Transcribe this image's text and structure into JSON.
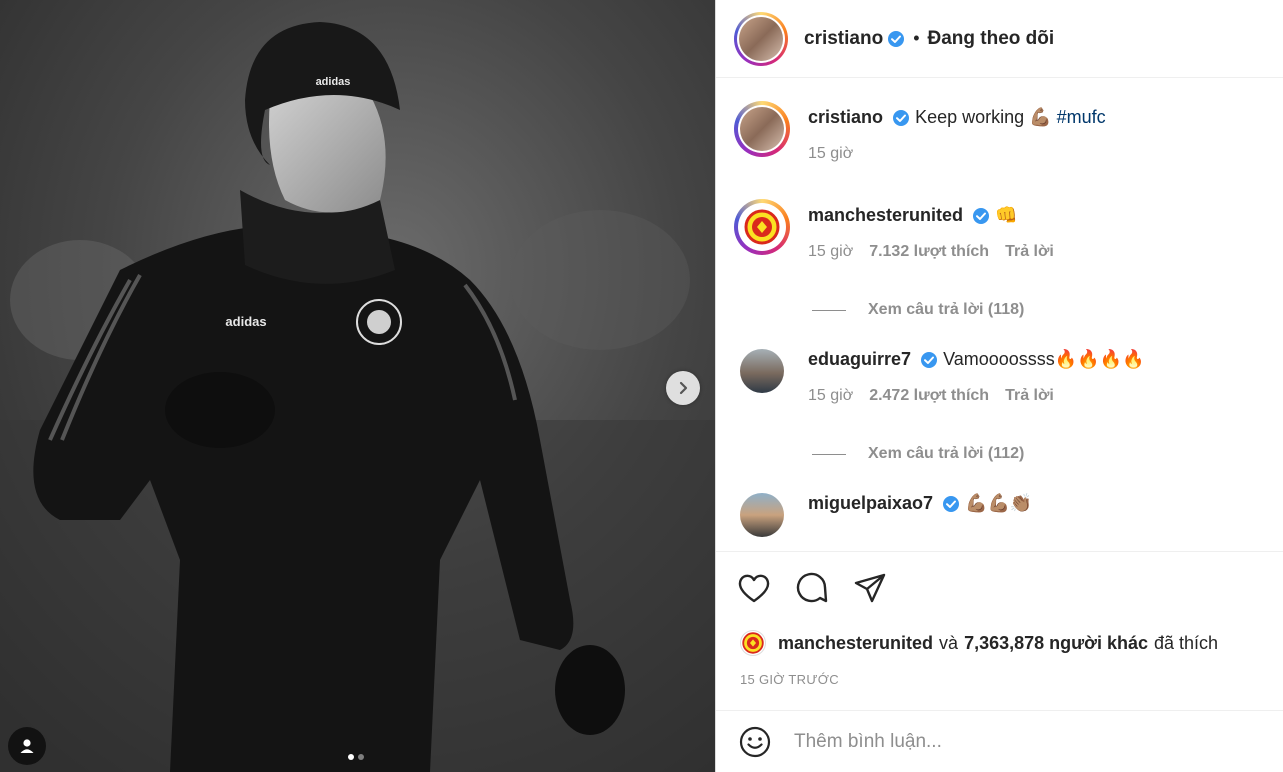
{
  "post": {
    "author": "cristiano",
    "follow_status": "Đang theo dõi",
    "caption_text": "Keep working 💪🏽",
    "hashtag": "#mufc",
    "caption_time": "15 giờ"
  },
  "comments": [
    {
      "user": "manchesterunited",
      "text": "👊",
      "time": "15 giờ",
      "likes": "7.132 lượt thích",
      "reply_label": "Trả lời",
      "view_replies": "Xem câu trả lời (118)"
    },
    {
      "user": "eduaguirre7",
      "text": "Vamoooossss🔥🔥🔥🔥",
      "time": "15 giờ",
      "likes": "2.472 lượt thích",
      "reply_label": "Trả lời",
      "view_replies": "Xem câu trả lời (112)"
    },
    {
      "user": "miguelpaixao7",
      "text": "💪🏽💪🏽👏🏽"
    }
  ],
  "liked_by": {
    "user": "manchesterunited",
    "conjunction": "và",
    "others": "7,363,878 người khác",
    "suffix": "đã thích"
  },
  "time_ago": "15 GIỜ TRƯỚC",
  "add_comment": {
    "placeholder": "Thêm bình luận..."
  },
  "icons": {
    "like": "heart-icon",
    "comment": "comment-bubble-icon",
    "share": "paper-plane-icon",
    "emoji": "smiley-icon",
    "next": "chevron-right-icon",
    "tag": "person-icon"
  },
  "colors": {
    "verified": "#3897f0",
    "hashtag": "#00376b",
    "muted": "#8e8e8e",
    "text": "#262626"
  }
}
